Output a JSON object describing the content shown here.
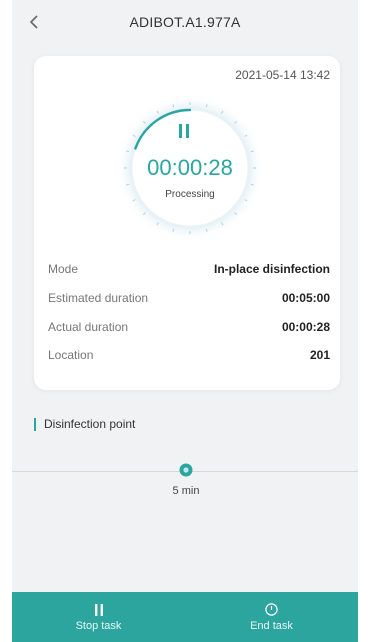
{
  "header": {
    "title": "ADIBOT.A1.977A",
    "back_icon": "chevron-left-icon"
  },
  "card": {
    "timestamp": "2021-05-14 13:42",
    "timer": "00:00:28",
    "status": "Processing",
    "pause_icon": "pause-icon",
    "progress_fraction": 0.093,
    "details": [
      {
        "label": "Mode",
        "value": "In-place disinfection"
      },
      {
        "label": "Estimated duration",
        "value": "00:05:00"
      },
      {
        "label": "Actual duration",
        "value": "00:00:28"
      },
      {
        "label": "Location",
        "value": "201"
      }
    ]
  },
  "disinfection_point": {
    "title": "Disinfection point",
    "marker_label": "5 min"
  },
  "actions": {
    "stop": {
      "label": "Stop task",
      "icon": "pause-icon"
    },
    "end": {
      "label": "End task",
      "icon": "power-icon"
    }
  },
  "colors": {
    "accent": "#2aa6a0",
    "action_bar": "#2ba59e",
    "background": "#f1f2f4"
  }
}
